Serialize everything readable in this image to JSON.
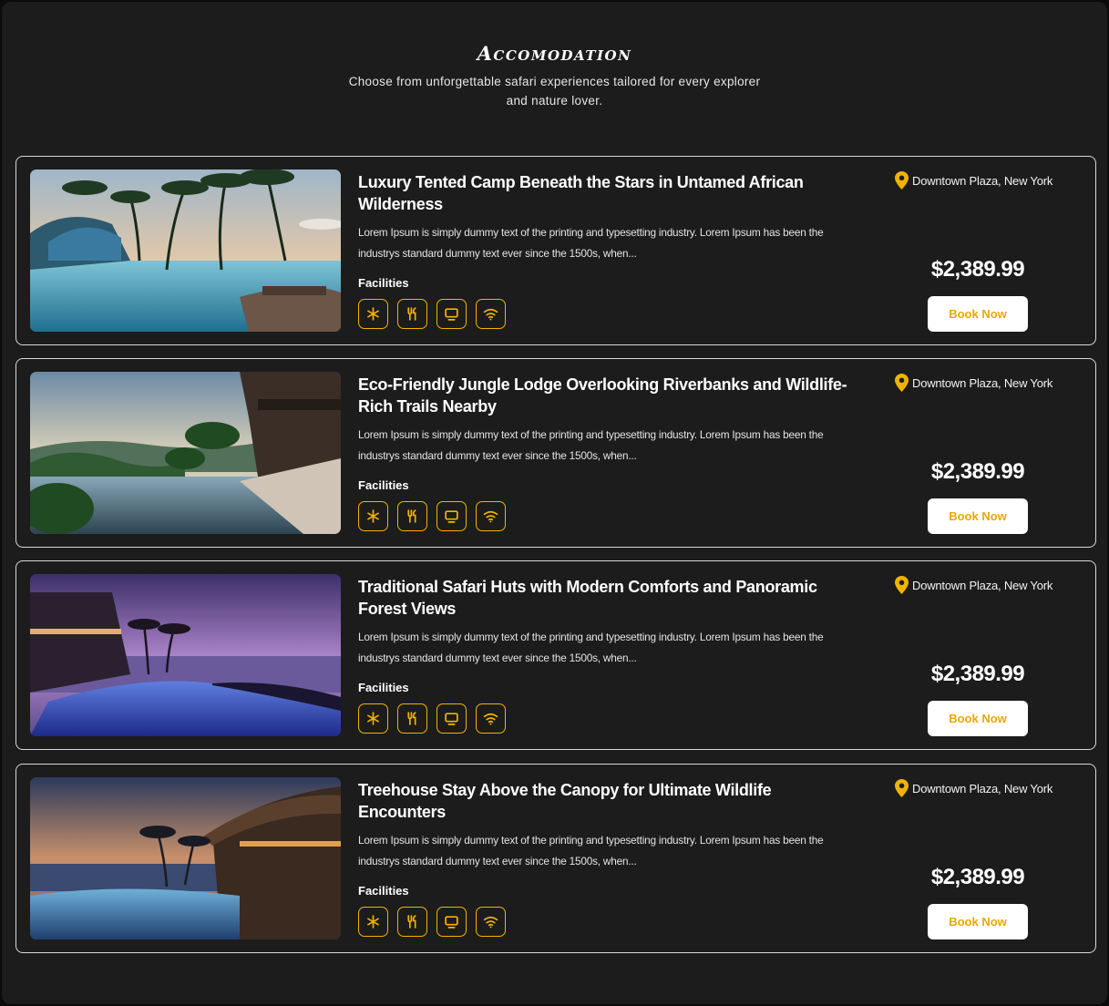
{
  "header": {
    "title": "Accomodation",
    "subtitle": "Choose from unforgettable safari experiences tailored for every explorer and nature lover."
  },
  "cards": [
    {
      "title": "Luxury Tented Camp Beneath the Stars in Untamed African Wilderness",
      "description": "Lorem Ipsum is simply dummy text of the printing and typesetting industry. Lorem Ipsum has been the industrys standard dummy text ever since the 1500s, when...",
      "facilities_label": "Facilities",
      "location": "Downtown Plaza, New York",
      "price": "$2,389.99",
      "book_label": "Book Now"
    },
    {
      "title": "Eco-Friendly Jungle Lodge Overlooking Riverbanks and Wildlife-Rich Trails Nearby",
      "description": "Lorem Ipsum is simply dummy text of the printing and typesetting industry. Lorem Ipsum has been the industrys standard dummy text ever since the 1500s, when...",
      "facilities_label": "Facilities",
      "location": "Downtown Plaza, New York",
      "price": "$2,389.99",
      "book_label": "Book Now"
    },
    {
      "title": "Traditional Safari Huts with Modern Comforts and Panoramic Forest Views",
      "description": "Lorem Ipsum is simply dummy text of the printing and typesetting industry. Lorem Ipsum has been the industrys standard dummy text ever since the 1500s, when...",
      "facilities_label": "Facilities",
      "location": "Downtown Plaza, New York",
      "price": "$2,389.99",
      "book_label": "Book Now"
    },
    {
      "title": "Treehouse Stay Above the Canopy for Ultimate Wildlife Encounters",
      "description": "Lorem Ipsum is simply dummy text of the printing and typesetting industry. Lorem Ipsum has been the industrys standard dummy text ever since the 1500s, when...",
      "facilities_label": "Facilities",
      "location": "Downtown Plaza, New York",
      "price": "$2,389.99",
      "book_label": "Book Now"
    }
  ],
  "facility_icons": [
    "snowflake-icon",
    "fork-knife-icon",
    "tv-icon",
    "wifi-icon"
  ],
  "colors": {
    "background": "#1c1c1c",
    "accent": "#f0b400",
    "card_border": "#d9d9d9",
    "button_bg": "#ffffff"
  }
}
